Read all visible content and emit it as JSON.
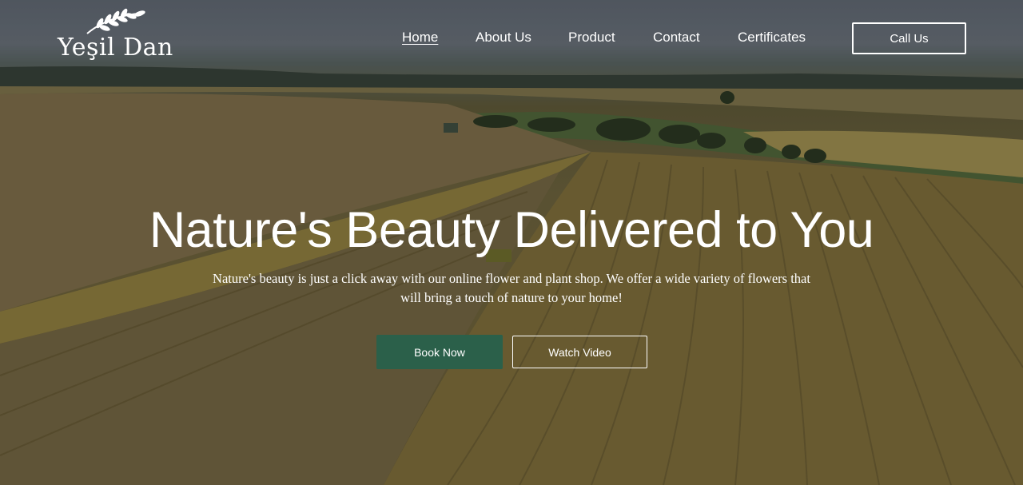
{
  "brand": {
    "name": "Yeşil Dan",
    "icon": "wheat-icon"
  },
  "nav": {
    "items": [
      {
        "label": "Home",
        "active": true
      },
      {
        "label": "About Us",
        "active": false
      },
      {
        "label": "Product",
        "active": false
      },
      {
        "label": "Contact",
        "active": false
      },
      {
        "label": "Certificates",
        "active": false
      }
    ],
    "call_label": "Call Us"
  },
  "hero": {
    "title": "Nature's Beauty Delivered to You",
    "subtitle": "Nature's beauty is just a click away with our online flower and plant shop. We offer a wide variety of flowers that will bring a touch of nature to your home!",
    "primary_button": "Book Now",
    "secondary_button": "Watch Video"
  },
  "colors": {
    "accent": "#2b604a",
    "text": "#ffffff"
  }
}
